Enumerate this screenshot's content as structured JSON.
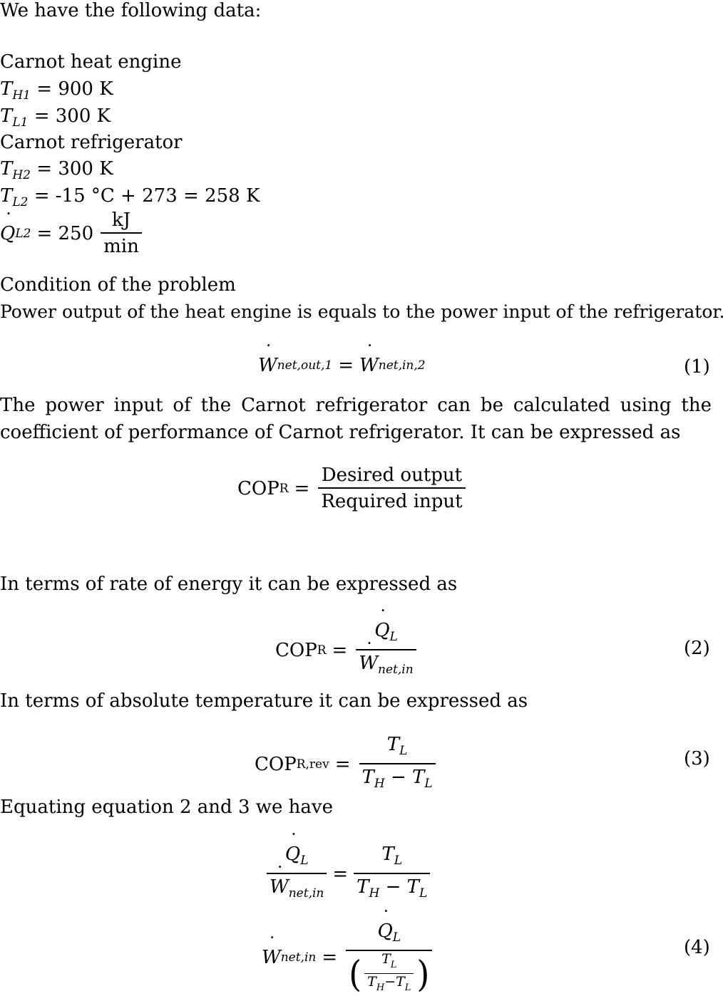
{
  "intro": "We have the following data:",
  "engine": {
    "heading": "Carnot heat engine",
    "TH1": {
      "sym": "T",
      "sub": "H1",
      "value": "= 900 K"
    },
    "TL1": {
      "sym": "T",
      "sub": "L1",
      "value": "= 300 K"
    }
  },
  "refrigerator": {
    "heading": "Carnot refrigerator",
    "TH2": {
      "sym": "T",
      "sub": "H2",
      "value": "= 300 K"
    },
    "TL2": {
      "sym": "T",
      "sub": "L2",
      "value": "= -15 °C + 273 = 258 K"
    },
    "QL2": {
      "sym": "Q",
      "sub": "L2",
      "value": "= 250",
      "unit_num": "kJ",
      "unit_den": "min"
    }
  },
  "condition": {
    "heading": "Condition of the problem",
    "text": "Power output of the heat engine is equals to the power input of the refrigerator."
  },
  "eq1": {
    "lhs_sym": "W",
    "lhs_sub": "net,out,1",
    "eq": "=",
    "rhs_sym": "W",
    "rhs_sub": "net,in,2",
    "number": "(1)"
  },
  "para1": {
    "line1": "The power input of the Carnot refrigerator can be calculated using the",
    "line2": "coefficient of performance of Carnot refrigerator. It can be expressed as"
  },
  "eq_cop_def": {
    "lhs": "COP",
    "lhs_sub": "R",
    "eq": "=",
    "num": "Desired output",
    "den": "Required input"
  },
  "para2": "In terms of rate of energy it can be expressed as",
  "eq2": {
    "lhs": "COP",
    "lhs_sub": "R",
    "eq": "=",
    "num_sym": "Q",
    "num_sub": "L",
    "den_sym": "W",
    "den_sub": "net,in",
    "number": "(2)"
  },
  "para3": "In terms of absolute temperature it can be expressed as",
  "eq3": {
    "lhs": "COP",
    "lhs_sub": "R,rev",
    "eq": "=",
    "num_sym": "T",
    "num_sub": "L",
    "den_a": "T",
    "den_a_sub": "H",
    "minus": "−",
    "den_b": "T",
    "den_b_sub": "L",
    "number": "(3)"
  },
  "para4": "Equating equation 2 and 3 we have",
  "eq_equate": {
    "eq": "="
  },
  "eq4": {
    "lhs_sym": "W",
    "lhs_sub": "net,in",
    "eq": "=",
    "number": "(4)",
    "lparen": "(",
    "rparen": ")"
  }
}
